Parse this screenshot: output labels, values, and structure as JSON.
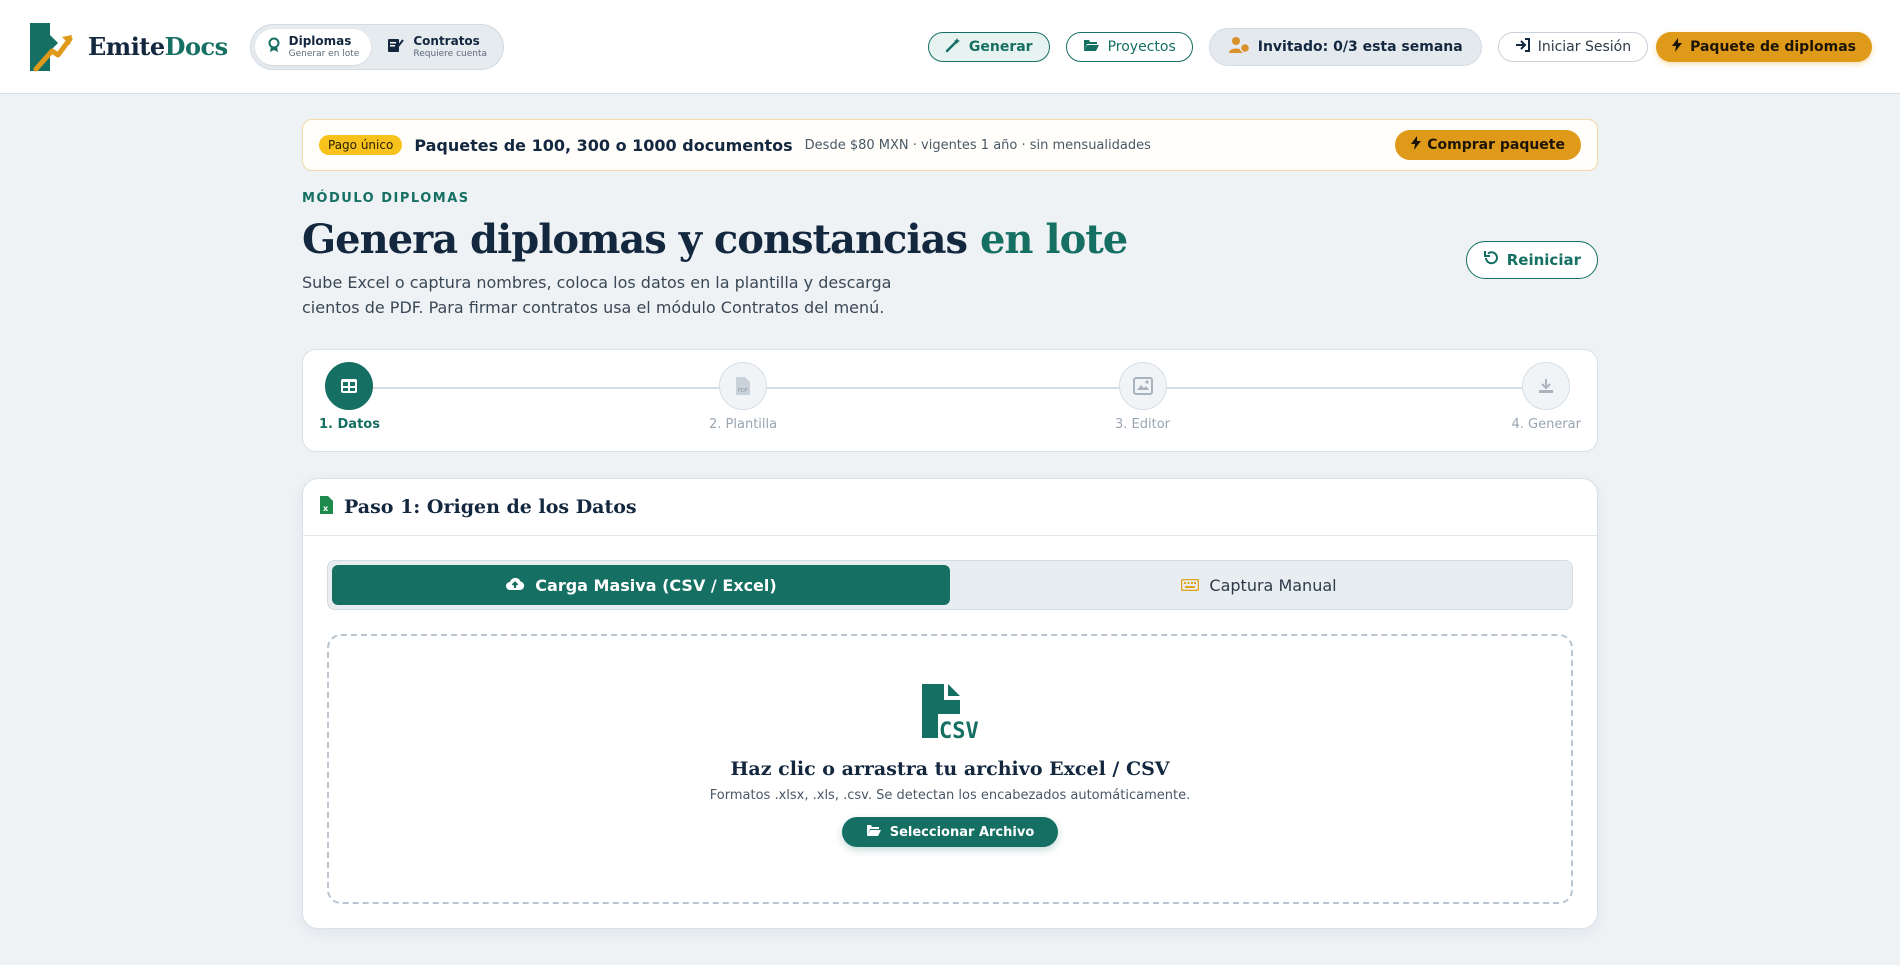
{
  "brand": {
    "name_part1": "Emite",
    "name_part2": "Docs"
  },
  "module_switch": [
    {
      "title": "Diplomas",
      "subtitle": "Generar en lote",
      "active": true
    },
    {
      "title": "Contratos",
      "subtitle": "Requiere cuenta",
      "active": false
    }
  ],
  "nav": {
    "generate": "Generar",
    "projects": "Proyectos",
    "guest": "Invitado: 0/3 esta semana",
    "login": "Iniciar Sesión",
    "pack": "Paquete de diplomas"
  },
  "promo": {
    "badge": "Pago único",
    "title": "Paquetes de 100, 300 o 1000 documentos",
    "subtitle": "Desde $80 MXN · vigentes 1 año · sin mensualidades",
    "button": "Comprar paquete"
  },
  "hero": {
    "eyebrow": "MÓDULO DIPLOMAS",
    "title_main": "Genera diplomas y constancias",
    "title_accent": "en lote",
    "subtitle": "Sube Excel o captura nombres, coloca los datos en la plantilla y descarga cientos de PDF. Para firmar contratos usa el módulo Contratos del menú.",
    "reset": "Reiniciar"
  },
  "steps": [
    {
      "label": "1. Datos",
      "icon": "table-icon",
      "active": true
    },
    {
      "label": "2. Plantilla",
      "icon": "pdf-icon",
      "active": false
    },
    {
      "label": "3. Editor",
      "icon": "image-edit-icon",
      "active": false
    },
    {
      "label": "4. Generar",
      "icon": "download-icon",
      "active": false
    }
  ],
  "card": {
    "title": "Paso 1: Origen de los Datos",
    "tabs": [
      {
        "label": "Carga Masiva (CSV / Excel)",
        "icon": "cloud-upload-icon",
        "active": true
      },
      {
        "label": "Captura Manual",
        "icon": "keyboard-icon",
        "active": false
      }
    ],
    "dropzone": {
      "icon_text": "CSV",
      "title": "Haz clic o arrastra tu archivo Excel / CSV",
      "subtitle": "Formatos .xlsx, .xls, .csv. Se detectan los encabezados automáticamente.",
      "button": "Seleccionar Archivo"
    }
  },
  "colors": {
    "primary": "#156f63",
    "accent": "#e09a1a",
    "badge": "#f6c21b",
    "navy": "#13273f",
    "background": "#eef2f5"
  }
}
